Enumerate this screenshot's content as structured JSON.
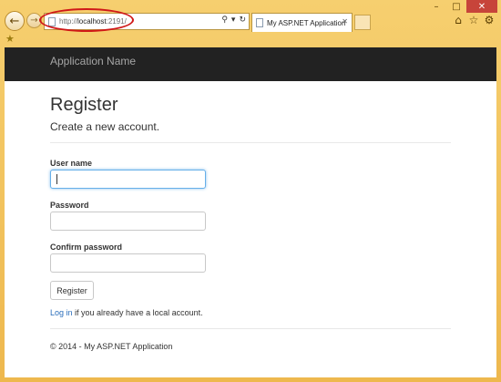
{
  "browser": {
    "address": {
      "url_prefix": "http://",
      "url_host": "localhost",
      "url_suffix": ":2191/"
    },
    "tab": {
      "title": "My ASP.NET Application"
    },
    "window_controls": {
      "minimize": "–",
      "maximize": "□",
      "close": "✕"
    },
    "toolbar_icons": [
      "home-icon",
      "star-icon",
      "gear-icon"
    ],
    "highlight_color": "#d01818"
  },
  "app": {
    "brand": "Application Name",
    "page_title": "Register",
    "subtitle": "Create a new account.",
    "form": {
      "username_label": "User name",
      "username_value": "",
      "password_label": "Password",
      "password_value": "",
      "confirm_label": "Confirm password",
      "confirm_value": "",
      "submit_label": "Register"
    },
    "login_link": "Log in",
    "login_text": " if you already have a local account.",
    "footer": "© 2014 - My ASP.NET Application",
    "colors": {
      "navbar": "#222222",
      "link": "#2a6ebb",
      "focus": "#66afe9"
    }
  }
}
